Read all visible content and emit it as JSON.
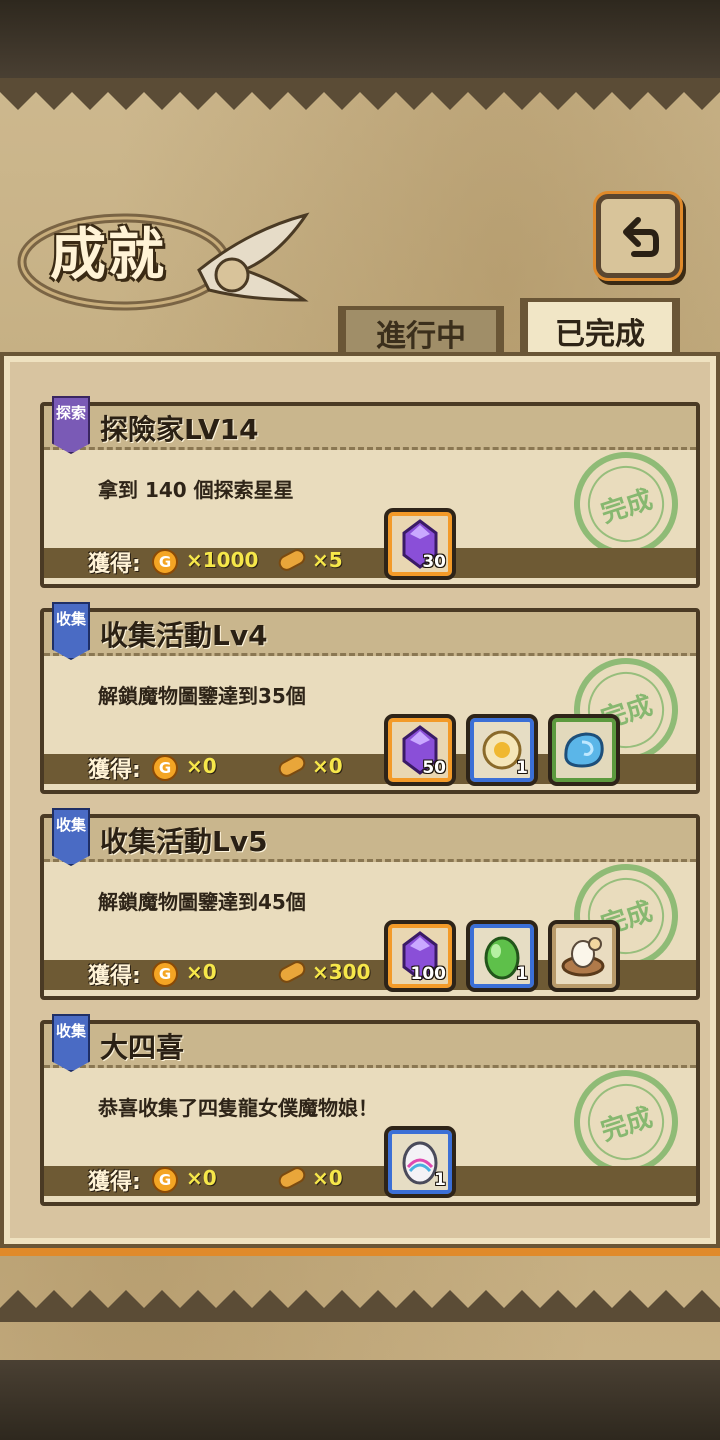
{
  "header": {
    "title": "成就",
    "back_icon": "return-arrow-icon",
    "tabs": [
      {
        "label": "進行中",
        "active": false
      },
      {
        "label": "已完成",
        "active": true
      }
    ]
  },
  "achievements": [
    {
      "badge": "探索",
      "title": "探險家LV14",
      "description": "拿到 140 個探索星星",
      "obtain_label": "獲得:",
      "coin_icon_letter": "G",
      "coins": "×1000",
      "bread": "×5",
      "stamp": "完成",
      "items": [
        {
          "icon": "purple-crystal-icon",
          "qty": "30"
        }
      ]
    },
    {
      "badge": "收集",
      "title": "收集活動Lv4",
      "description": "解鎖魔物圖鑒達到35個",
      "obtain_label": "獲得:",
      "coin_icon_letter": "G",
      "coins": "×0",
      "bread": "×0",
      "stamp": "完成",
      "items": [
        {
          "icon": "purple-crystal-icon",
          "qty": "50"
        },
        {
          "icon": "golden-creature-icon",
          "qty": "1"
        },
        {
          "icon": "blue-shell-icon",
          "qty": ""
        }
      ]
    },
    {
      "badge": "收集",
      "title": "收集活動Lv5",
      "description": "解鎖魔物圖鑒達到45個",
      "obtain_label": "獲得:",
      "coin_icon_letter": "G",
      "coins": "×0",
      "bread": "×300",
      "stamp": "完成",
      "items": [
        {
          "icon": "purple-crystal-icon",
          "qty": "100"
        },
        {
          "icon": "green-egg-icon",
          "qty": "1"
        },
        {
          "icon": "nest-chick-icon",
          "qty": ""
        }
      ]
    },
    {
      "badge": "收集",
      "title": "大四喜",
      "description": "恭喜收集了四隻龍女僕魔物娘！",
      "obtain_label": "獲得:",
      "coin_icon_letter": "G",
      "coins": "×0",
      "bread": "×0",
      "stamp": "完成",
      "items": [
        {
          "icon": "rainbow-egg-icon",
          "qty": "1"
        }
      ]
    }
  ],
  "colors": {
    "accent_orange": "#f39a28",
    "stamp_green": "#46a03c",
    "value_yellow": "#f6e74a"
  }
}
